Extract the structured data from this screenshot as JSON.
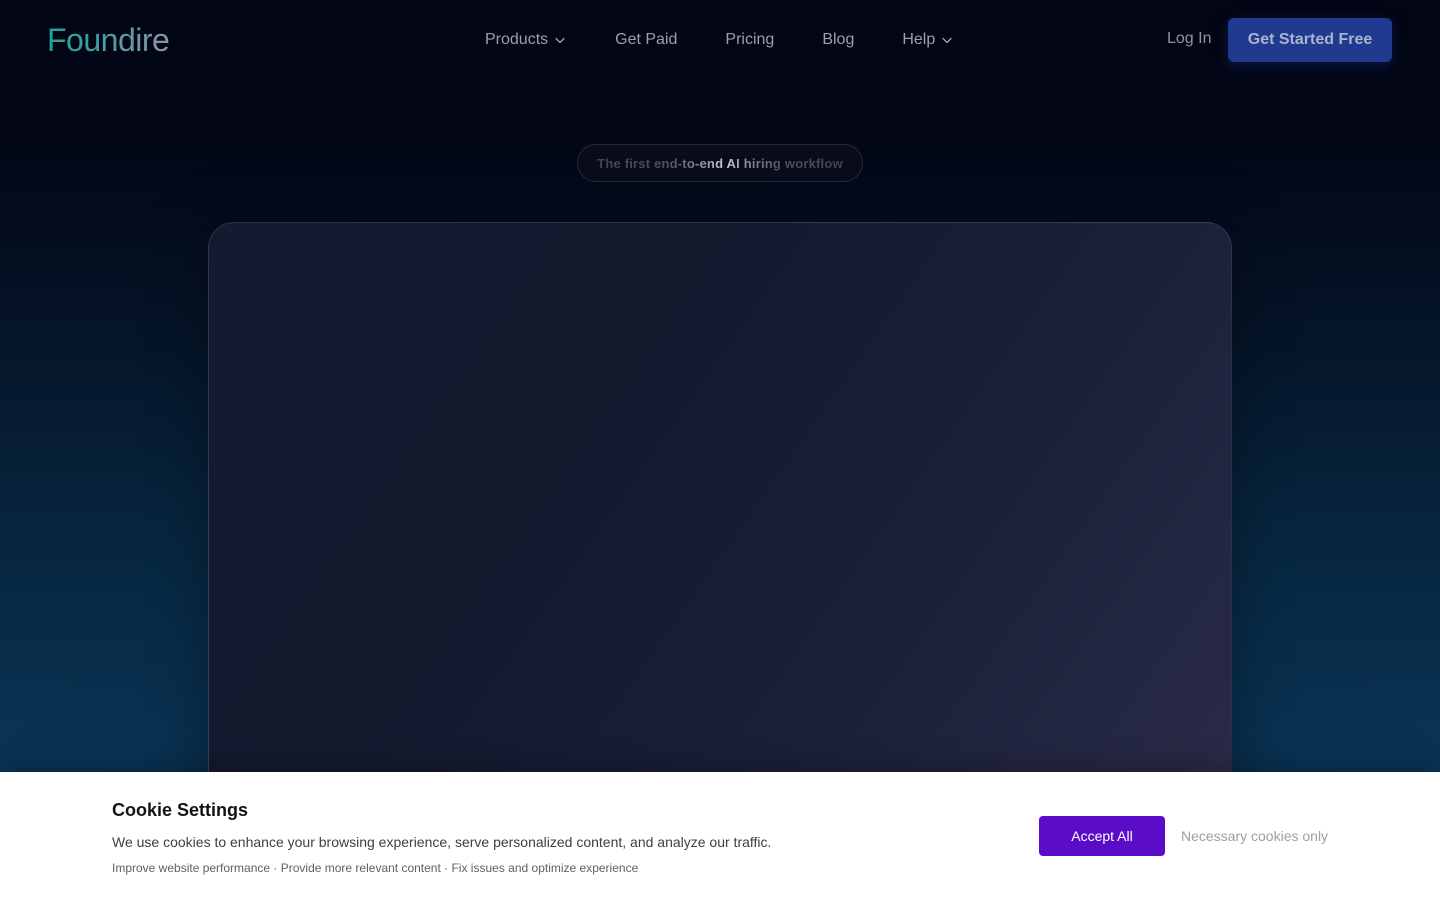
{
  "brand": {
    "logo_text": "Foundire"
  },
  "nav": {
    "items": [
      {
        "label": "Products",
        "has_dropdown": true
      },
      {
        "label": "Get Paid",
        "has_dropdown": false
      },
      {
        "label": "Pricing",
        "has_dropdown": false
      },
      {
        "label": "Blog",
        "has_dropdown": false
      },
      {
        "label": "Help",
        "has_dropdown": true
      }
    ],
    "login_label": "Log In",
    "cta_label": "Get Started Free"
  },
  "hero": {
    "badge_text": "The first end-to-end AI hiring workflow"
  },
  "cookie_banner": {
    "title": "Cookie Settings",
    "description": "We use cookies to enhance your browsing experience, serve personalized content, and analyze our traffic.",
    "features": "Improve website performance · Provide more relevant content · Fix issues and optimize experience",
    "accept_label": "Accept All",
    "necessary_label": "Necessary cookies only"
  },
  "colors": {
    "accent_button": "#1f3a8f",
    "accept_button": "#5b0cc6",
    "logo_teal": "#1aa39a",
    "background_dark": "#030712"
  },
  "icons": [
    "chevron-down-icon"
  ]
}
